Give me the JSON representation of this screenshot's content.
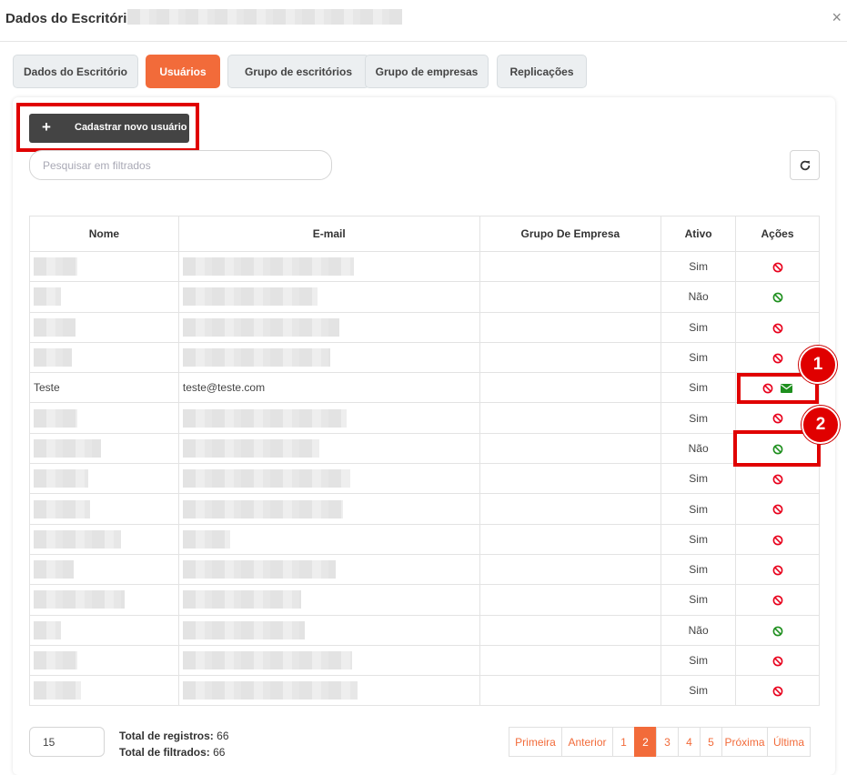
{
  "modal": {
    "title": "Dados do Escritório",
    "close_label": "×"
  },
  "tabs": [
    {
      "label": "Dados do Escritório"
    },
    {
      "label": "Usuários"
    },
    {
      "label": "Grupo de escritórios"
    },
    {
      "label": "Grupo de empresas"
    },
    {
      "label": "Replicações"
    }
  ],
  "active_tab": "Usuários",
  "toolbar": {
    "add_label": "Cadastrar novo usuário",
    "add_icon": "+"
  },
  "search": {
    "placeholder": "Pesquisar em filtrados",
    "value": ""
  },
  "table": {
    "headers": [
      "Nome",
      "E-mail",
      "Grupo De Empresa",
      "Ativo",
      "Ações"
    ],
    "rows": [
      {
        "nome": "",
        "email": "",
        "grupo": "",
        "ativo": "Sim",
        "action": "deactivate"
      },
      {
        "nome": "",
        "email": "",
        "grupo": "",
        "ativo": "Não",
        "action": "activate"
      },
      {
        "nome": "",
        "email": "",
        "grupo": "",
        "ativo": "Sim",
        "action": "deactivate"
      },
      {
        "nome": "",
        "email": "",
        "grupo": "",
        "ativo": "Sim",
        "action": "deactivate"
      },
      {
        "nome": "Teste",
        "email": "teste@teste.com",
        "grupo": "",
        "ativo": "Sim",
        "action": "deactivate",
        "mail": true
      },
      {
        "nome": "",
        "email": "",
        "grupo": "",
        "ativo": "Sim",
        "action": "deactivate"
      },
      {
        "nome": "",
        "email": "",
        "grupo": "",
        "ativo": "Não",
        "action": "activate"
      },
      {
        "nome": "",
        "email": "",
        "grupo": "",
        "ativo": "Sim",
        "action": "deactivate"
      },
      {
        "nome": "",
        "email": "",
        "grupo": "",
        "ativo": "Sim",
        "action": "deactivate"
      },
      {
        "nome": "",
        "email": "",
        "grupo": "",
        "ativo": "Sim",
        "action": "deactivate"
      },
      {
        "nome": "",
        "email": "",
        "grupo": "",
        "ativo": "Sim",
        "action": "deactivate"
      },
      {
        "nome": "",
        "email": "",
        "grupo": "",
        "ativo": "Sim",
        "action": "deactivate"
      },
      {
        "nome": "",
        "email": "",
        "grupo": "",
        "ativo": "Não",
        "action": "activate"
      },
      {
        "nome": "",
        "email": "",
        "grupo": "",
        "ativo": "Sim",
        "action": "deactivate"
      },
      {
        "nome": "",
        "email": "",
        "grupo": "",
        "ativo": "Sim",
        "action": "deactivate"
      }
    ]
  },
  "annotations": [
    "1",
    "2"
  ],
  "footer": {
    "page_size": "15",
    "total_registros_label": "Total de registros:",
    "total_registros": "66",
    "total_filtrados_label": "Total de filtrados:",
    "total_filtrados": "66"
  },
  "pagination": [
    "Primeira",
    "Anterior",
    "1",
    "2",
    "3",
    "4",
    "5",
    "Próxima",
    "Última"
  ],
  "current_page": "2",
  "colors": {
    "accent": "#f26b3a",
    "deactivate_icon": "#e8001c",
    "activate_icon": "#1e8f1e",
    "annotation_red": "#e00000"
  }
}
